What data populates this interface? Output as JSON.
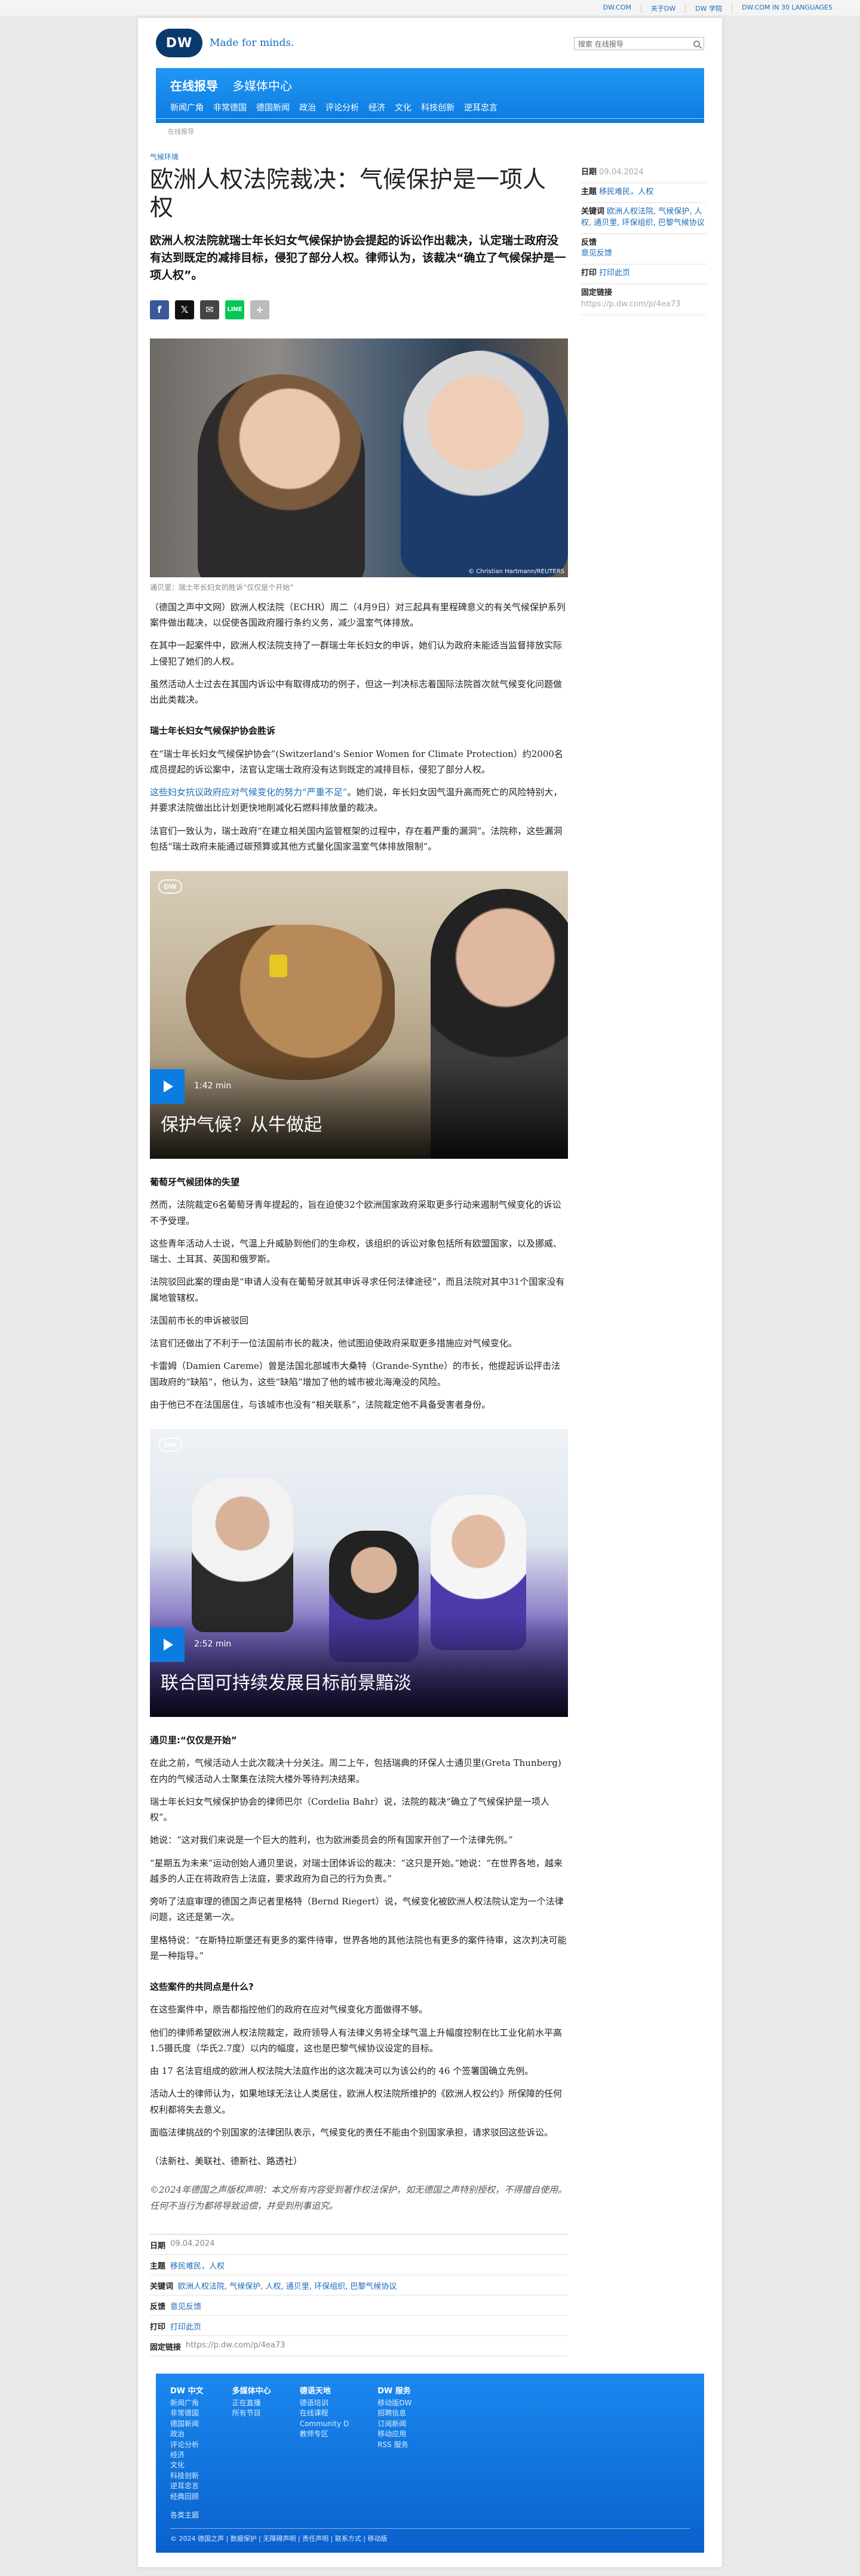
{
  "topbar": {
    "links": [
      "DW.COM",
      "关于DW",
      "DW 学院",
      "DW.COM IN 30 LANGUAGES"
    ]
  },
  "header": {
    "logo_text": "DW",
    "tagline": "Made for minds.",
    "search_placeholder": "搜索 在线报导"
  },
  "nav": {
    "main": [
      "在线报导",
      "多媒体中心"
    ],
    "sub": [
      "新闻广角",
      "非常德国",
      "德国新闻",
      "政治",
      "评论分析",
      "经济",
      "文化",
      "科技创新",
      "逆耳忠言"
    ]
  },
  "breadcrumb": "在线报导",
  "article": {
    "kicker": "气候环境",
    "title": "欧洲人权法院裁决：气候保护是一项人权",
    "lead": "欧洲人权法院就瑞士年长妇女气候保护协会提起的诉讼作出裁决，认定瑞士政府没有达到既定的减排目标，侵犯了部分人权。律师认为，该裁决“确立了气候保护是一项人权”。",
    "share": [
      "f",
      "𝕏",
      "✉",
      "LINE",
      "+"
    ],
    "hero_credit": "© Christian Hartmann/REUTERS",
    "hero_caption": "通贝里：瑞士年长妇女的胜诉“仅仅是个开始”",
    "p1": "（德国之声中文网）欧洲人权法院（ECHR）周二（4月9日）对三起具有里程碑意义的有关气候保护系列案件做出裁决，以促使各国政府履行条约义务，减少温室气体排放。",
    "p2": "在其中一起案件中，欧洲人权法院支持了一群瑞士年长妇女的申诉，她们认为政府未能适当监督排放实际上侵犯了她们的人权。",
    "p3": "虽然活动人士过去在其国内诉讼中有取得成功的例子，但这一判决标志着国际法院首次就气候变化问题做出此类裁决。",
    "h1": "瑞士年长妇女气候保护协会胜诉",
    "p4": "在“瑞士年长妇女气候保护协会”(Switzerland's Senior Women for Climate Protection）约2000名成员提起的诉讼案中，法官认定瑞士政府没有达到既定的减排目标，侵犯了部分人权。",
    "p5_link": "这些妇女抗议政府应对气候变化的努力“严重不足”",
    "p5_rest": "。她们说，年长妇女因气温升高而死亡的风险特别大，并要求法院做出比计划更快地削减化石燃料排放量的裁决。",
    "p6": "法官们一致认为，瑞士政府“在建立相关国内监管框架的过程中，存在着严重的漏洞”。法院称，这些漏洞包括“瑞士政府未能通过碳预算或其他方式量化国家温室气体排放限制”。",
    "video1": {
      "logo": "DW",
      "duration": "1:42 min",
      "title": "保护气候？从牛做起"
    },
    "h2": "葡萄牙气候团体的失望",
    "p7": "然而，法院裁定6名葡萄牙青年提起的，旨在迫使32个欧洲国家政府采取更多行动来遏制气候变化的诉讼不予受理。",
    "p8": "这些青年活动人士说，气温上升威胁到他们的生命权，该组织的诉讼对象包括所有欧盟国家，以及挪威、瑞士、土耳其、英国和俄罗斯。",
    "p9": "法院驳回此案的理由是“申请人没有在葡萄牙就其申诉寻求任何法律途径”，而且法院对其中31个国家没有属地管辖权。",
    "p9b": "法国前市长的申诉被驳回",
    "p10": "法官们还做出了不利于一位法国前市长的裁决，他试图迫使政府采取更多措施应对气候变化。",
    "p11": "卡雷姆（Damien Careme）曾是法国北部城市大桑特（Grande-Synthe）的市长，他提起诉讼抨击法国政府的“缺陷”，他认为，这些“缺陷”增加了他的城市被北海淹没的风险。",
    "p12": "由于他已不在法国居住，与该城市也没有“相关联系”，法院裁定他不具备受害者身份。",
    "video2": {
      "logo": "DW",
      "duration": "2:52 min",
      "title": "联合国可持续发展目标前景黯淡"
    },
    "h3": "通贝里:“仅仅是开始”",
    "p13": "在此之前，气候活动人士此次裁决十分关注。周二上午，包括瑞典的环保人士通贝里(Greta Thunberg)在内的气候活动人士聚集在法院大楼外等待判决结果。",
    "p14": "瑞士年长妇女气候保护协会的律师巴尔（Cordelia Bahr）说，法院的裁决“确立了气候保护是一项人权”。",
    "p15": "她说：“这对我们来说是一个巨大的胜利，也为欧洲委员会的所有国家开创了一个法律先例。”",
    "p16": "“星期五为未来”运动创始人通贝里说，对瑞士团体诉讼的裁决：“这只是开始。”她说：“在世界各地，越来越多的人正在将政府告上法庭，要求政府为自己的行为负责。”",
    "p17": "旁听了法庭审理的德国之声记者里格特（Bernd Riegert）说，气候变化被欧洲人权法院认定为一个法律问题，这还是第一次。",
    "p18": "里格特说：“在斯特拉斯堡还有更多的案件待审，世界各地的其他法院也有更多的案件待审，这次判决可能是一种指导。”",
    "h4": "这些案件的共同点是什么?",
    "p19": "在这些案件中，原告都指控他们的政府在应对气候变化方面做得不够。",
    "p20": "他们的律师希望欧洲人权法院裁定，政府领导人有法律义务将全球气温上升幅度控制在比工业化前水平高1.5摄氏度（华氏2.7度）以内的幅度，这也是巴黎气候协议设定的目标。",
    "p21": "由 17 名法官组成的欧洲人权法院大法庭作出的这次裁决可以为该公约的 46 个签署国确立先例。",
    "p22": "活动人士的律师认为，如果地球无法让人类居住，欧洲人权法院所维护的《欧洲人权公约》所保障的任何权利都将失去意义。",
    "p23": "面临法律挑战的个别国家的法律团队表示，气候变化的责任不能由个别国家承担，请求驳回这些诉讼。",
    "source": "（法新社、美联社、德新社、路透社）",
    "copyright": "©2024年德国之声版权声明：本文所有内容受到著作权法保护，如无德国之声特别授权，不得擅自使用。任何不当行为都将导致追偿，并受到刑事追究。"
  },
  "meta": {
    "date_label": "日期",
    "date": "09.04.2024",
    "topic_label": "主题",
    "topic": "移民难民，人权",
    "keywords_label": "关键词",
    "keywords": "欧洲人权法院, 气候保护, 人权, 通贝里, 环保组织, 巴黎气候协议",
    "feedback_label": "反馈",
    "feedback": "意见反馈",
    "print_label": "打印",
    "print": "打印此页",
    "permalink_label": "固定链接",
    "permalink": "https://p.dw.com/p/4ea73"
  },
  "footer": {
    "columns": [
      {
        "title": "DW 中文",
        "items": [
          "新闻广角",
          "非常德国",
          "德国新闻",
          "政治",
          "评论分析",
          "经济",
          "文化",
          "科技创新",
          "逆耳忠言",
          "经典回顾",
          "",
          "各类主题"
        ]
      },
      {
        "title": "多媒体中心",
        "items": [
          "正在直播",
          "所有节目"
        ]
      },
      {
        "title": "德语天地",
        "items": [
          "德语培训",
          "在线课程",
          "Community D",
          "教师专区"
        ]
      },
      {
        "title": "DW 服务",
        "items": [
          "移动版DW",
          "招聘信息",
          "订阅新闻",
          "移动应用",
          "RSS 服务"
        ]
      }
    ],
    "copyright": "© 2024 德国之声 | 数据保护 | 无障碍声明 | 责任声明 | 联系方式 | 移动版"
  }
}
